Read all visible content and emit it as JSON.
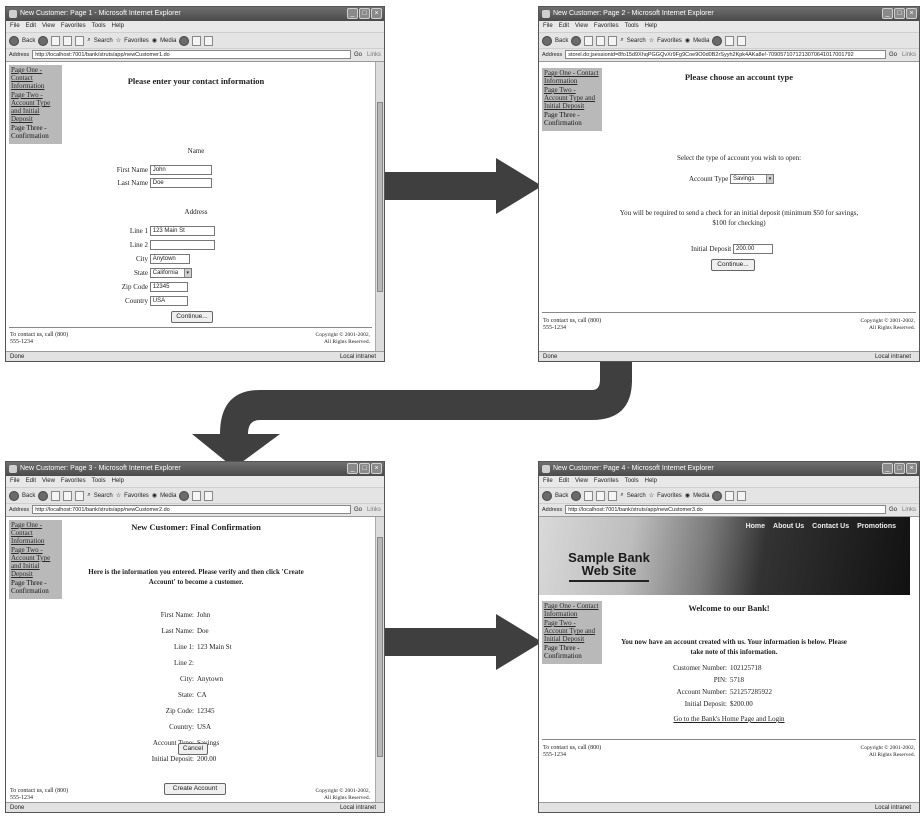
{
  "common": {
    "menu": [
      "File",
      "Edit",
      "View",
      "Favorites",
      "Tools",
      "Help"
    ],
    "back": "Back",
    "search": "Search",
    "favorites": "Favorites",
    "media": "Media",
    "address_label": "Address",
    "go": "Go",
    "links": "Links",
    "sidebar": {
      "page_one": "Page One - Contact Information",
      "page_two": "Page Two - Account Type and Initial Deposit",
      "page_three": "Page Three - Confirmation"
    },
    "footer_left": "To contact us, call (800) 555-1234",
    "footer_right": "Copyright © 2001-2002, All Rights Reserved.",
    "status_done": "Done",
    "status_zone": "Local intranet"
  },
  "page1": {
    "title": "New Customer: Page 1 - Microsoft Internet Explorer",
    "address": "http://localhost:7001/bank/struts/app/newCustomer1.do",
    "heading": "Please enter your contact information",
    "name_section": "Name",
    "first_name_label": "First Name",
    "first_name_value": "John",
    "last_name_label": "Last Name",
    "last_name_value": "Doe",
    "address_section": "Address",
    "line1_label": "Line 1",
    "line1_value": "123 Main St",
    "line2_label": "Line 2",
    "line2_value": "",
    "city_label": "City",
    "city_value": "Anytown",
    "state_label": "State",
    "state_value": "California",
    "zip_label": "Zip Code",
    "zip_value": "12345",
    "country_label": "Country",
    "country_value": "USA",
    "continue": "Continue..."
  },
  "page2": {
    "title": "New Customer: Page 2 - Microsoft Internet Explorer",
    "address": "storel.do;jsessionid=8fo15d9XhqPGGQvXr9Fg9Coe9O0d0B2rSyyh2Kpk4AKa8e!-7090571071213070641017001792",
    "heading": "Please choose an account type",
    "instruction": "Select the type of account you wish to open:",
    "account_type_label": "Account Type",
    "account_type_value": "Savings",
    "deposit_note": "You will be required to send a check for an initial deposit (minimum $50 for savings, $100 for checking)",
    "initial_deposit_label": "Initial Deposit",
    "initial_deposit_value": "200.00",
    "continue": "Continue..."
  },
  "page3": {
    "title": "New Customer: Page 3 - Microsoft Internet Explorer",
    "address": "http://localhost:7001/bank/struts/app/newCustomer2.do",
    "heading": "New Customer: Final Confirmation",
    "intro": "Here is the information you entered. Please verify and then click 'Create Account' to become a customer.",
    "rows": [
      {
        "label": "First Name:",
        "value": "John"
      },
      {
        "label": "Last Name:",
        "value": "Doe"
      },
      {
        "label": "Line 1:",
        "value": "123 Main St"
      },
      {
        "label": "Line 2:",
        "value": ""
      },
      {
        "label": "City:",
        "value": "Anytown"
      },
      {
        "label": "State:",
        "value": "CA"
      },
      {
        "label": "Zip Code:",
        "value": "12345"
      },
      {
        "label": "Country:",
        "value": "USA"
      },
      {
        "label": "Account Type:",
        "value": "Savings"
      },
      {
        "label": "Initial Deposit:",
        "value": "200.00"
      }
    ],
    "create_account": "Create Account",
    "cancel": "Cancel"
  },
  "page4": {
    "title": "New Customer: Page 4 - Microsoft Internet Explorer",
    "address": "http://localhost:7001/bank/struts/app/newCustomer3.do",
    "nav": [
      "Home",
      "About Us",
      "Contact Us",
      "Promotions"
    ],
    "brand_line1": "Sample Bank",
    "brand_line2": "Web Site",
    "heading": "Welcome to our Bank!",
    "intro": "You now have an account created with us. Your information is below. Please take note of this information.",
    "rows": [
      {
        "label": "Customer Number:",
        "value": "102125718"
      },
      {
        "label": "PIN:",
        "value": "5718"
      },
      {
        "label": "Account Number:",
        "value": "521257285922"
      },
      {
        "label": "Initial Deposit:",
        "value": "$200.00"
      }
    ],
    "home_link": "Go to the Bank's Home Page and Login"
  },
  "colors": {
    "arrow": "#3f3f3f",
    "sidebar": "#b9b9b9",
    "titlebar": "#555555"
  }
}
